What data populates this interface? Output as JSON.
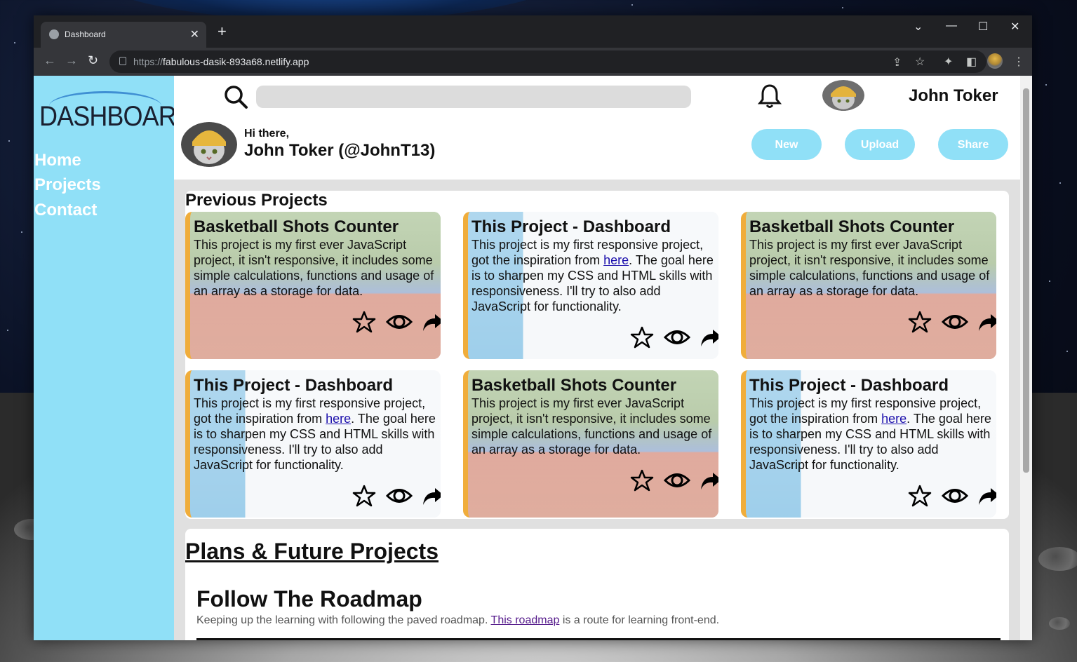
{
  "browser": {
    "tab_title": "Dashboard",
    "tab_close": "✕",
    "new_tab": "+",
    "url_prefix": "https://",
    "url_host": "fabulous-dasik-893a68.netlify.app",
    "win_minimize": "—",
    "win_maximize": "☐",
    "win_close": "✕",
    "win_dropdown": "⌄"
  },
  "sidebar": {
    "logo_text": "DASHBOARD",
    "logo_mark": "®",
    "items": [
      {
        "label": "Home"
      },
      {
        "label": "Projects"
      },
      {
        "label": "Contact"
      }
    ]
  },
  "header": {
    "search_placeholder": "",
    "user_name": "John Toker",
    "greeting_small": "Hi there,",
    "greeting_big": "John Toker (@JohnT13)",
    "buttons": [
      {
        "label": "New"
      },
      {
        "label": "Upload"
      },
      {
        "label": "Share"
      }
    ]
  },
  "projects": {
    "heading": "Previous Projects",
    "cards": [
      {
        "title": "Basketball Shots Counter",
        "desc": "This project is my first ever JavaScript project, it isn't responsive, it includes some simple calculations, functions and usage of an array as a storage for data."
      },
      {
        "title": "This Project - Dashboard",
        "desc_before": "This project is my first responsive project, got the inspiration from ",
        "link": "here",
        "desc_after": ". The goal here is to sharpen my CSS and HTML skills with responsiveness. I'll try to also add JavaScript for functionality."
      },
      {
        "title": "Basketball Shots Counter",
        "desc": "This project is my first ever JavaScript project, it isn't responsive, it includes some simple calculations, functions and usage of an array as a storage for data."
      },
      {
        "title": "This Project - Dashboard",
        "desc_before": "This project is my first responsive project, got the inspiration from ",
        "link": "here",
        "desc_after": ". The goal here is to sharpen my CSS and HTML skills with responsiveness. I'll try to also add JavaScript for functionality."
      },
      {
        "title": "Basketball Shots Counter",
        "desc": "This project is my first ever JavaScript project, it isn't responsive, it includes some simple calculations, functions and usage of an array as a storage for data."
      },
      {
        "title": "This Project - Dashboard",
        "desc_before": "This project is my first responsive project, got the inspiration from ",
        "link": "here",
        "desc_after": ". The goal here is to sharpen my CSS and HTML skills with responsiveness. I'll try to also add JavaScript for functionality."
      }
    ]
  },
  "plans": {
    "heading": "Plans & Future Projects",
    "subheading": "Follow The Roadmap",
    "text_before": "Keeping up the learning with following the paved roadmap. ",
    "link": "This roadmap",
    "text_after": " is a route for learning front-end."
  },
  "colors": {
    "sidebar": "#90e0f7",
    "accent_border": "#f0ad3b",
    "button": "#90e0f7"
  },
  "icons": [
    "search-icon",
    "bell-icon",
    "star-icon",
    "eye-icon",
    "share-arrow-icon"
  ]
}
